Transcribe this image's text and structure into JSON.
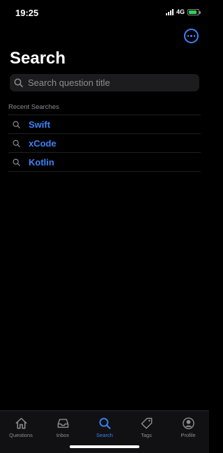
{
  "status_bar": {
    "time": "19:25",
    "network": "4G"
  },
  "header": {
    "title": "Search"
  },
  "search": {
    "placeholder": "Search question title"
  },
  "recent": {
    "header": "Recent Searches",
    "items": [
      {
        "label": "Swift"
      },
      {
        "label": "xCode"
      },
      {
        "label": "Kotlin"
      }
    ]
  },
  "tabs": [
    {
      "label": "Questions",
      "icon": "house-icon",
      "active": false
    },
    {
      "label": "Inbox",
      "icon": "inbox-tray-icon",
      "active": false
    },
    {
      "label": "Search",
      "icon": "magnifying-glass-icon",
      "active": true
    },
    {
      "label": "Tags",
      "icon": "tag-icon",
      "active": false
    },
    {
      "label": "Profile",
      "icon": "person-circle-icon",
      "active": false
    }
  ],
  "colors": {
    "accent": "#3b82f6",
    "background": "#000000",
    "search_field": "#1c1c1e",
    "secondary_text": "#8e8e93",
    "battery": "#30d158"
  }
}
